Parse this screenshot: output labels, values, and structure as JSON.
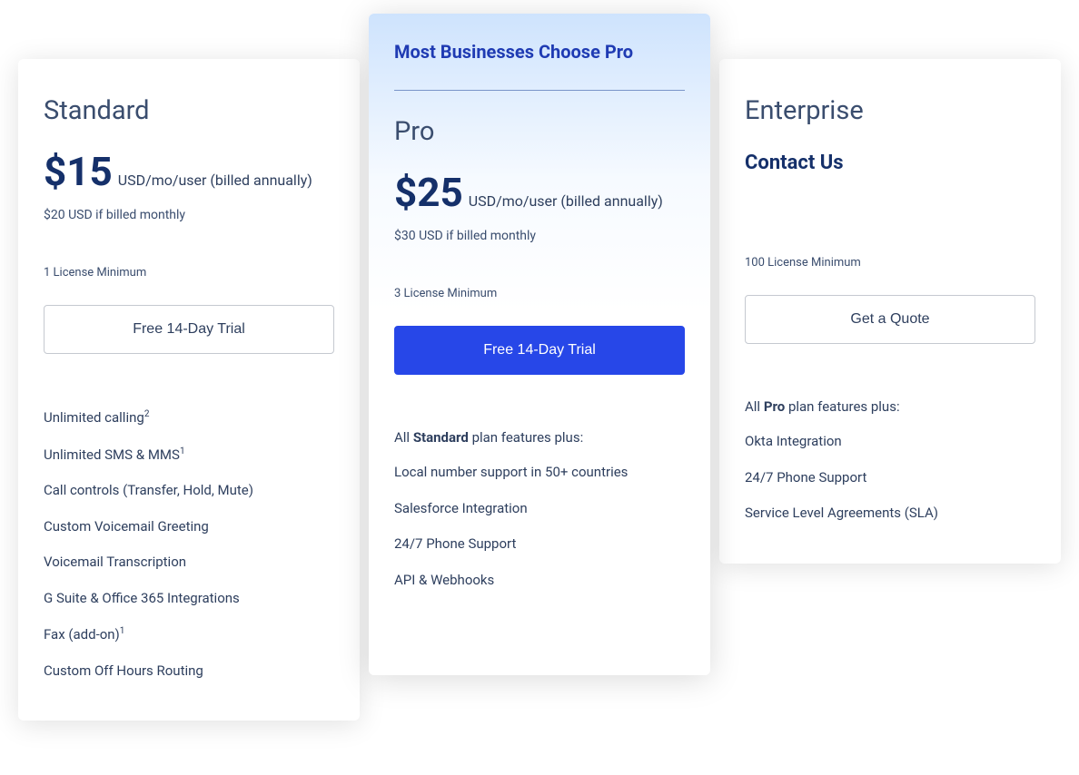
{
  "featured_label": "Most Businesses Choose Pro",
  "plans": {
    "standard": {
      "name": "Standard",
      "price": "$15",
      "price_unit": "USD/mo/user (billed annually)",
      "monthly_note": "$20 USD if billed monthly",
      "license_min": "1 License Minimum",
      "cta": "Free 14-Day Trial",
      "features": [
        {
          "text": "Unlimited calling",
          "sup": "2"
        },
        {
          "text": "Unlimited SMS & MMS",
          "sup": "1"
        },
        {
          "text": "Call controls (Transfer, Hold, Mute)"
        },
        {
          "text": "Custom Voicemail Greeting"
        },
        {
          "text": "Voicemail Transcription"
        },
        {
          "text": "G Suite & Office 365 Integrations"
        },
        {
          "text": "Fax (add-on)",
          "sup": "1"
        },
        {
          "text": "Custom Off Hours Routing"
        }
      ]
    },
    "pro": {
      "name": "Pro",
      "price": "$25",
      "price_unit": "USD/mo/user (billed annually)",
      "monthly_note": "$30 USD if billed monthly",
      "license_min": "3 License Minimum",
      "cta": "Free 14-Day Trial",
      "intro_prefix": "All ",
      "intro_bold": "Standard",
      "intro_suffix": " plan features plus:",
      "features": [
        {
          "text": "Local number support in 50+ countries"
        },
        {
          "text": "Salesforce Integration"
        },
        {
          "text": "24/7 Phone Support"
        },
        {
          "text": "API & Webhooks"
        }
      ]
    },
    "enterprise": {
      "name": "Enterprise",
      "contact": "Contact Us",
      "license_min": "100 License Minimum",
      "cta": "Get a Quote",
      "intro_prefix": "All ",
      "intro_bold": "Pro",
      "intro_suffix": " plan features plus:",
      "features": [
        {
          "text": "Okta Integration"
        },
        {
          "text": "24/7 Phone Support"
        },
        {
          "text": "Service Level Agreements (SLA)"
        }
      ]
    }
  }
}
